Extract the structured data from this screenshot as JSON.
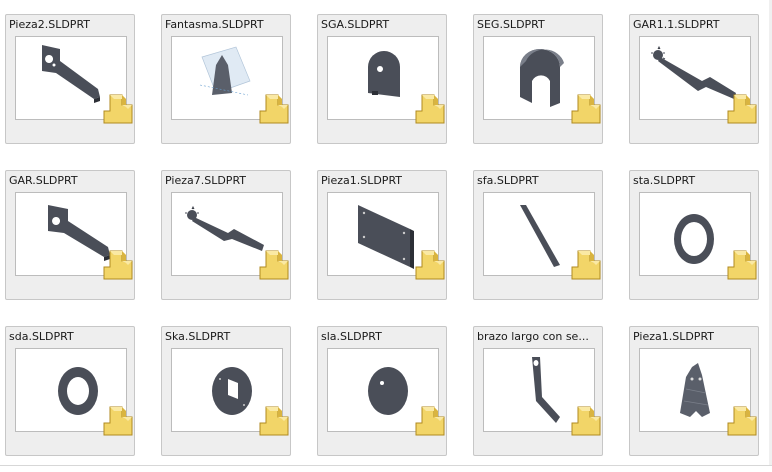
{
  "files": [
    {
      "name": "Pieza2.SLDPRT",
      "icon": "flat-bracket-part-icon"
    },
    {
      "name": "Fantasma.SLDPRT",
      "icon": "ghost-shape-part-icon"
    },
    {
      "name": "SGA.SLDPRT",
      "icon": "rounded-plate-part-icon"
    },
    {
      "name": "SEG.SLDPRT",
      "icon": "arch-block-part-icon"
    },
    {
      "name": "GAR1.1.SLDPRT",
      "icon": "claw-arm-part-icon"
    },
    {
      "name": "GAR.SLDPRT",
      "icon": "flat-bracket-part-icon"
    },
    {
      "name": "Pieza7.SLDPRT",
      "icon": "claw-arm-part-icon"
    },
    {
      "name": "Pieza1.SLDPRT",
      "icon": "rectangular-plate-part-icon"
    },
    {
      "name": "sfa.SLDPRT",
      "icon": "diagonal-bar-part-icon"
    },
    {
      "name": "sta.SLDPRT",
      "icon": "ring-part-icon"
    },
    {
      "name": "sda.SLDPRT",
      "icon": "ring-part-icon"
    },
    {
      "name": "Ska.SLDPRT",
      "icon": "disc-square-hole-part-icon"
    },
    {
      "name": "sla.SLDPRT",
      "icon": "disc-part-icon"
    },
    {
      "name": "brazo largo con se...",
      "icon": "long-arm-part-icon"
    },
    {
      "name": "Pieza1.SLDPRT",
      "icon": "cone-ghost-part-icon"
    }
  ],
  "colors": {
    "tile_bg": "#eeeeee",
    "part_gray": "#4a4e58",
    "badge_yellow": "#f2d568"
  }
}
